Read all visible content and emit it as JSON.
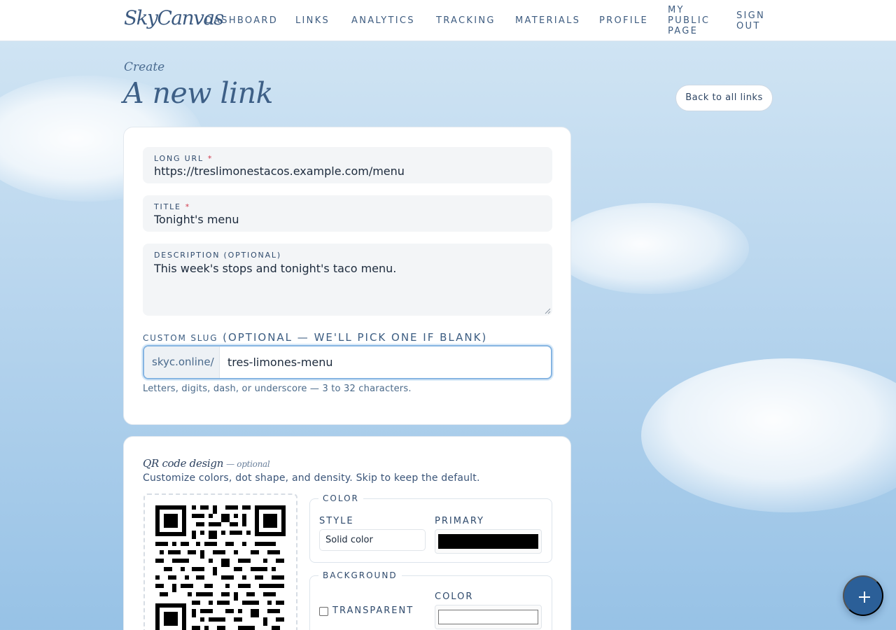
{
  "brand": "SkyCanvas",
  "nav": {
    "dashboard": "DASHBOARD",
    "links": "LINKS",
    "analytics": "ANALYTICS",
    "tracking": "TRACKING",
    "materials": "MATERIALS",
    "profile": "PROFILE",
    "public_page": [
      "MY",
      "PUBLIC",
      "PAGE"
    ],
    "sign_out": [
      "SIGN",
      "OUT"
    ]
  },
  "header": {
    "eyebrow": "Create",
    "title": "A new link",
    "back_button": "Back to all links"
  },
  "form": {
    "long_url": {
      "label": "LONG URL",
      "required_mark": "*",
      "value": "https://treslimonestacos.example.com/menu"
    },
    "title": {
      "label": "TITLE",
      "required_mark": "*",
      "value": "Tonight's menu"
    },
    "description": {
      "label": "DESCRIPTION (OPTIONAL)",
      "value": "This week's stops and tonight's taco menu."
    },
    "slug": {
      "label": "CUSTOM SLUG",
      "label_note": "(OPTIONAL — WE'LL PICK ONE IF BLANK)",
      "prefix": "skyc.online/",
      "value": "tres-limones-menu",
      "hint": "Letters, digits, dash, or underscore — 3 to 32 characters."
    }
  },
  "qr": {
    "title": "QR code design",
    "title_note": "— optional",
    "subtitle": "Customize colors, dot shape, and density. Skip to keep the default.",
    "color_group": {
      "legend": "COLOR",
      "style_label": "STYLE",
      "style_value": "Solid color",
      "primary_label": "PRIMARY",
      "primary_color": "#000000"
    },
    "background_group": {
      "legend": "BACKGROUND",
      "transparent_label": "TRANSPARENT",
      "transparent_checked": false,
      "color_label": "COLOR",
      "color_value": "#ffffff"
    }
  },
  "fab_icon": "plus-icon",
  "colors": {
    "accent": "#2b5f98",
    "nav_text": "#3e5c80",
    "required": "#d0384b",
    "focus_border": "#86b5e2"
  }
}
